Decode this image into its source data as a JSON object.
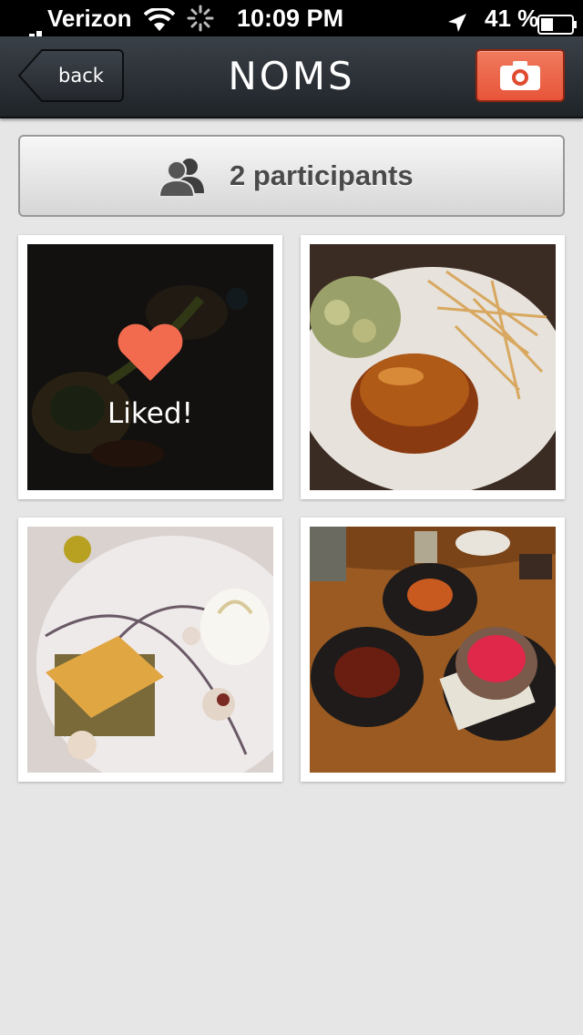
{
  "status_bar": {
    "carrier": "Verizon",
    "time": "10:09 PM",
    "battery_percent": "41 %",
    "signal_icon": "signal-bars-icon",
    "wifi_icon": "wifi-icon",
    "activity_icon": "activity-spinner-icon",
    "location_icon": "location-arrow-icon",
    "battery_icon": "battery-icon",
    "battery_level": 0.41
  },
  "nav": {
    "back_label": "back",
    "title": "NOMS",
    "camera_icon": "camera-icon",
    "accent_color": "#e8553a"
  },
  "participants": {
    "label": "2 participants",
    "icon": "people-icon"
  },
  "photos": [
    {
      "description_icon": "food-photo",
      "liked": true,
      "liked_label": "Liked!",
      "heart_color": "#f26b4f"
    },
    {
      "description_icon": "food-photo",
      "liked": false
    },
    {
      "description_icon": "food-photo",
      "liked": false
    },
    {
      "description_icon": "food-photo",
      "liked": false
    }
  ]
}
